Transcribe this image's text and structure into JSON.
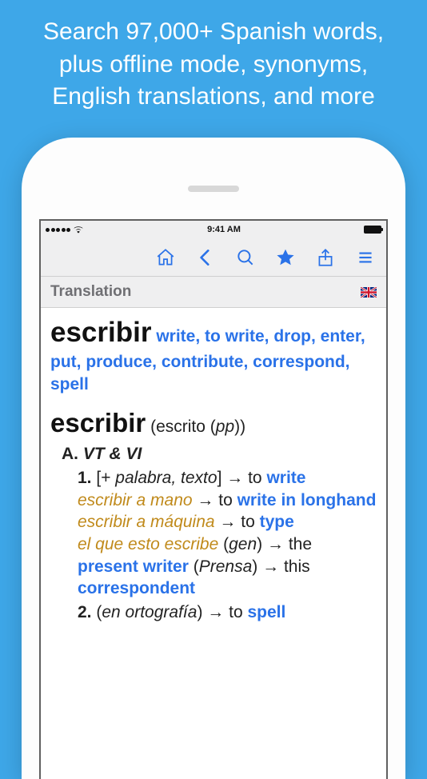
{
  "promo": {
    "line1": "Search 97,000+ Spanish words,",
    "line2": "plus offline mode, synonyms,",
    "line3": "English translations, and more"
  },
  "status": {
    "time": "9:41 AM"
  },
  "section": {
    "title": "Translation"
  },
  "translation": {
    "headword": "escribir",
    "equivalents": "write, to write, drop, enter, put, produce, contribute, correspond, spell"
  },
  "entry": {
    "headword": "escribir",
    "variant_open": "(",
    "variant_form": "escrito",
    "variant_type_open": "(",
    "variant_type": "pp",
    "variant_type_close": ")",
    "variant_close": ")",
    "sectionA": {
      "letter": "A.",
      "pos": "VT & VI",
      "sense1": {
        "num": "1.",
        "context_open": "[+ ",
        "context_words": "palabra, texto",
        "context_close": "]",
        "arrow": " → ",
        "target": "write",
        "ex1_phrase": "escribir a mano",
        "ex1_arrow": " → ",
        "ex1_pre": "to ",
        "ex1_target": "write in longhand",
        "ex2_phrase": "escribir a máquina",
        "ex2_arrow": " → ",
        "ex2_pre": "to ",
        "ex2_target": "type",
        "ex3_phrase": "el que esto escribe",
        "ex3_paren_open": " (",
        "ex3_label": "gen",
        "ex3_paren_close": ") ",
        "ex3_arrow": "→ ",
        "ex3_pre": "the ",
        "ex3_target": "present writer",
        "ex3b_paren_open": " (",
        "ex3b_label": "Prensa",
        "ex3b_paren_close": ") ",
        "ex3b_arrow": "→ ",
        "ex3b_pre": "this ",
        "ex3b_target": "correspondent"
      },
      "sense2": {
        "num": "2.",
        "context_open": "(",
        "context_words": "en ortografía",
        "context_close": ")",
        "arrow": " → ",
        "pre": "to ",
        "target": "spell"
      }
    }
  }
}
